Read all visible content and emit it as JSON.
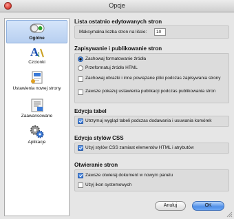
{
  "window": {
    "title": "Opcje"
  },
  "sidebar": {
    "items": [
      {
        "label": "Ogólne",
        "icon": "switch-icon",
        "selected": true
      },
      {
        "label": "Czcionki",
        "icon": "font-icon",
        "selected": false
      },
      {
        "label": "Ustawienia nowej strony",
        "icon": "new-page-icon",
        "selected": false
      },
      {
        "label": "Zaawansowane",
        "icon": "advanced-icon",
        "selected": false
      },
      {
        "label": "Aplikacje",
        "icon": "gears-icon",
        "selected": false
      }
    ]
  },
  "sections": {
    "recent": {
      "title": "Lista ostatnio edytowanych stron",
      "max_label": "Maksymalna liczba stron na liście:",
      "max_value": "10"
    },
    "saving": {
      "title": "Zapisywanie i publikowanie stron",
      "radio1": "Zachowaj formatowanie źródła",
      "radio1_checked": true,
      "radio2": "Przeformatuj źródło HTML",
      "radio2_checked": false,
      "check1": "Zachowaj obrazki i inne powiązane pliki podczas zapisywania strony",
      "check1_checked": false,
      "check2": "Zawsze pokazuj ustawienia publikacji podczas publikowania stron",
      "check2_checked": false
    },
    "tables": {
      "title": "Edycja tabel",
      "check1": "Utrzymuj wygląd tabeli podczas dodawania i usuwania komórek",
      "check1_checked": true
    },
    "css": {
      "title": "Edycja stylów CSS",
      "check1": "Użyj stylów CSS zamiast elementów HTML i atrybutów",
      "check1_checked": true
    },
    "open": {
      "title": "Otwieranie stron",
      "check1": "Zawsze otwieraj dokument w nowym panelu",
      "check1_checked": true,
      "check2": "Użyj ikon systemowych",
      "check2_checked": false
    }
  },
  "buttons": {
    "cancel": "Anuluj",
    "ok": "OK"
  }
}
